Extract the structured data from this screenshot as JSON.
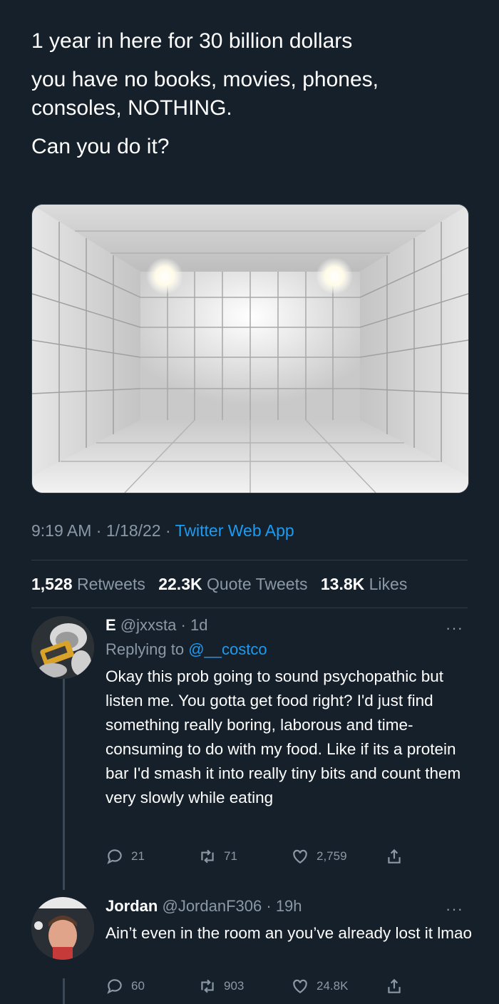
{
  "tweet": {
    "lines": [
      "1 year in here for 30 billion dollars",
      "you have no books, movies, phones, consoles, NOTHING.",
      "Can you do it?"
    ],
    "time": "9:19 AM",
    "date": "1/18/22",
    "source": "Twitter Web App",
    "separator": "·"
  },
  "stats": {
    "retweets_count": "1,528",
    "retweets_label": "Retweets",
    "quotes_count": "22.3K",
    "quotes_label": "Quote Tweets",
    "likes_count": "13.8K",
    "likes_label": "Likes"
  },
  "replies": [
    {
      "name": "E",
      "handle": "@jxxsta",
      "age": "1d",
      "replying_prefix": "Replying to",
      "replying_handle": "@__costco",
      "text": "Okay this prob going to sound psychopathic but listen me. You gotta get food right? I'd just find something really boring, laborous and time-consuming to do with my food. Like if its a protein bar I'd smash it into really tiny bits and count them very slowly while eating",
      "replies": "21",
      "retweets": "71",
      "likes": "2,759",
      "more": "···"
    },
    {
      "name": "Jordan",
      "handle": "@JordanF306",
      "age": "19h",
      "text": "Ain’t even in the room an you’ve already lost it lmao",
      "replies": "60",
      "retweets": "903",
      "likes": "24.8K",
      "more": "···"
    }
  ],
  "icons": {
    "reply": "reply-icon",
    "retweet": "retweet-icon",
    "like": "heart-icon",
    "share": "share-icon"
  },
  "colors": {
    "background": "#15202b",
    "accent": "#1d9bf0",
    "muted": "#8b98a5"
  }
}
